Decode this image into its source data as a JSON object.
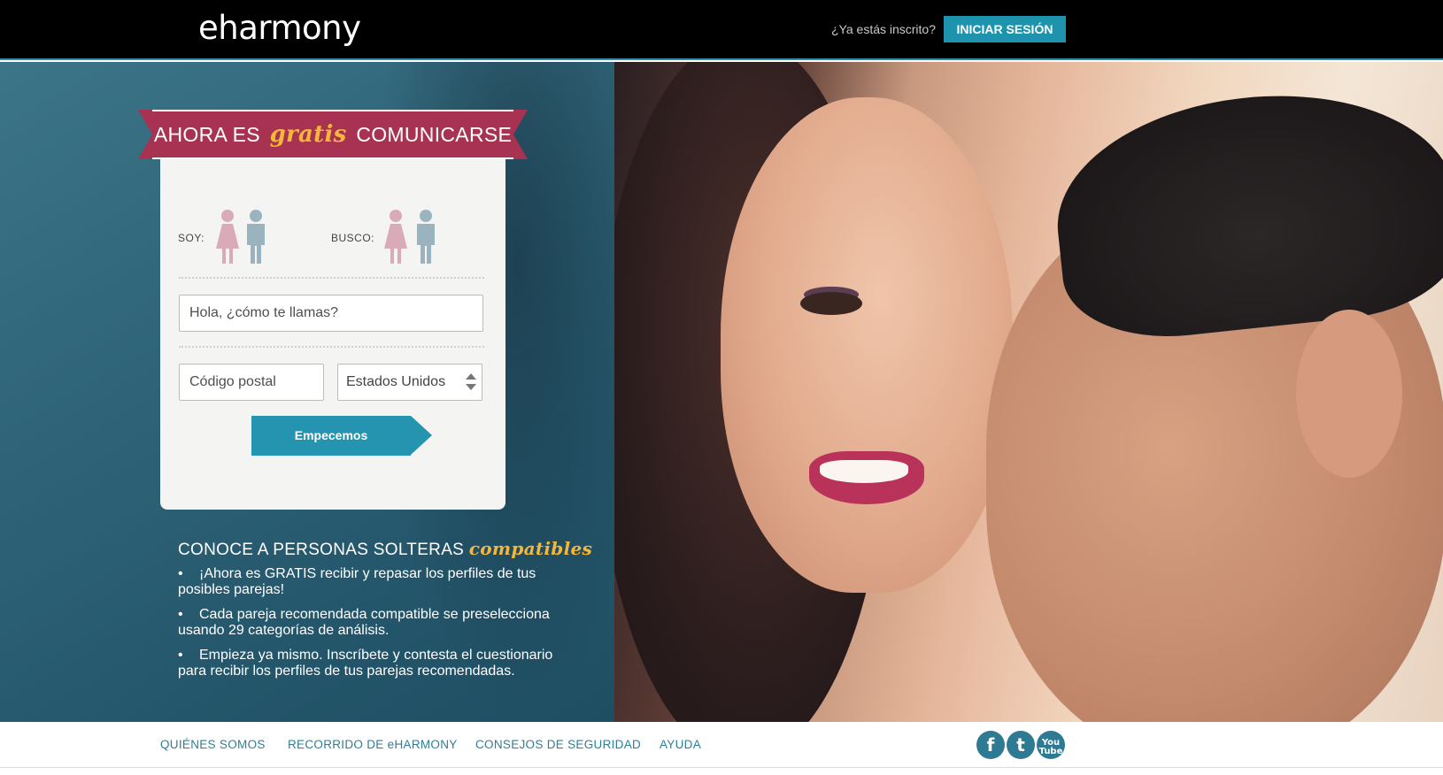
{
  "header": {
    "logo": "eharmony",
    "already_registered": "¿Ya estás inscrito?",
    "login_label": "INICIAR SESIÓN"
  },
  "promo": {
    "prefix": "AHORA ES",
    "highlight": "gratis",
    "suffix": "COMUNICARSE"
  },
  "form": {
    "soy_label": "SOY:",
    "busco_label": "BUSCO:",
    "name_placeholder": "Hola, ¿cómo te llamas?",
    "zip_placeholder": "Código postal",
    "country_value": "Estados Unidos",
    "submit_label": "Empecemos"
  },
  "features": {
    "title_prefix": "CONOCE A PERSONAS SOLTERAS",
    "title_highlight": "compatibles",
    "items": [
      "¡Ahora es GRATIS recibir y repasar los perfiles de tus posibles parejas!",
      "Cada pareja recomendada compatible se preselecciona usando 29 categorías de análisis.",
      "Empieza ya mismo. Inscríbete y contesta el cuestionario para recibir los perfiles de tus parejas recomendadas."
    ]
  },
  "footer": {
    "links": [
      "QUIÉNES SOMOS",
      "RECORRIDO DE eHARMONY",
      "CONSEJOS DE SEGURIDAD",
      "AYUDA"
    ],
    "social": [
      {
        "name": "facebook-icon",
        "glyph": "f"
      },
      {
        "name": "twitter-icon",
        "glyph": "t"
      },
      {
        "name": "youtube-icon",
        "glyph": "You Tube"
      }
    ]
  },
  "colors": {
    "accent": "#1e93ad",
    "ribbon": "#a83251",
    "highlight": "#f4b73c",
    "female_icon": "#d9aab8",
    "male_icon": "#9ab3bf"
  }
}
